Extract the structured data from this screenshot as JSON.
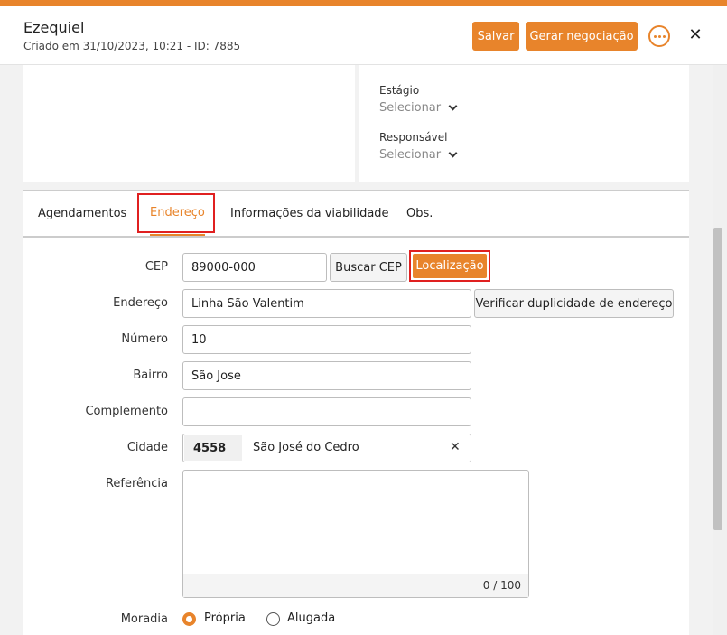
{
  "header": {
    "title": "Ezequiel",
    "subtitle": "Criado em 31/10/2023, 10:21 - ID: 7885",
    "save_label": "Salvar",
    "generate_label": "Gerar negociação"
  },
  "right_card": {
    "stage_label": "Estágio",
    "stage_value": "Selecionar",
    "owner_label": "Responsável",
    "owner_value": "Selecionar"
  },
  "tabs": [
    {
      "label": "Agendamentos"
    },
    {
      "label": "Endereço",
      "active": true
    },
    {
      "label": "Informações da viabilidade"
    },
    {
      "label": "Obs."
    }
  ],
  "form": {
    "cep_label": "CEP",
    "cep_value": "89000-000",
    "buscar_cep_label": "Buscar CEP",
    "localizacao_label": "Localização",
    "endereco_label": "Endereço",
    "endereco_value": "Linha São Valentim",
    "verificar_label": "Verificar duplicidade de endereço",
    "numero_label": "Número",
    "numero_value": "10",
    "bairro_label": "Bairro",
    "bairro_value": "São Jose",
    "complemento_label": "Complemento",
    "complemento_value": "",
    "cidade_label": "Cidade",
    "cidade_code": "4558",
    "cidade_name": "São José do Cedro",
    "referencia_label": "Referência",
    "referencia_counter": "0 / 100",
    "moradia_label": "Moradia",
    "moradia_options": [
      "Própria",
      "Alugada"
    ]
  },
  "colors": {
    "accent": "#e8842b",
    "highlight": "#e02020"
  }
}
